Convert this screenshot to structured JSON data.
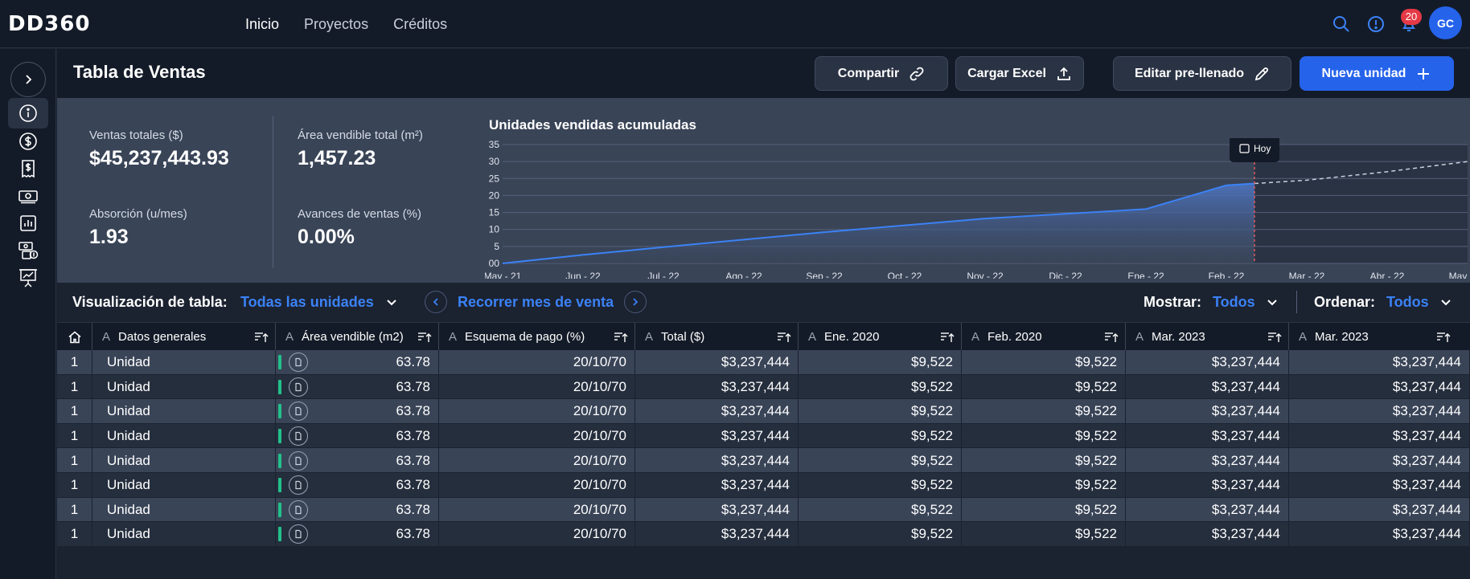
{
  "app": {
    "logo_text": "DD360"
  },
  "topnav": {
    "items": [
      "Inicio",
      "Proyectos",
      "Créditos"
    ],
    "active": "Inicio"
  },
  "notifications": {
    "count": "20"
  },
  "user": {
    "initials": "GC"
  },
  "colors": {
    "accent": "#2563eb",
    "link": "#3b82f6",
    "positive": "#22c08a",
    "badge": "#e53946",
    "today_marker": "#e05a5a"
  },
  "sidebar": {
    "icons": [
      "chevron-right-icon",
      "info-icon",
      "dollar-icon",
      "receipt-icon",
      "banknote-icon",
      "bar-chart-icon",
      "money-stack-icon",
      "presentation-chart-icon"
    ],
    "active": "info-icon"
  },
  "header": {
    "title": "Tabla de Ventas",
    "buttons": {
      "share": "Compartir",
      "upload": "Cargar Excel",
      "edit": "Editar pre-llenado",
      "new": "Nueva unidad"
    }
  },
  "kpis": {
    "total_sales_label": "Ventas totales ($)",
    "total_sales_value": "$45,237,443.93",
    "area_label": "Área vendible total (m²)",
    "area_value": "1,457.23",
    "absorption_label": "Absorción (u/mes)",
    "absorption_value": "1.93",
    "progress_label": "Avances de ventas (%)",
    "progress_value": "0.00%"
  },
  "chart_data": {
    "type": "area",
    "title": "Unidades vendidas acumuladas",
    "x": [
      "May - 21",
      "Jun - 22",
      "Jul - 22",
      "Ago - 22",
      "Sep - 22",
      "Oct - 22",
      "Nov - 22",
      "Dic - 22",
      "Ene - 22",
      "Feb - 22",
      "Mar - 22",
      "Abr - 22",
      "May - 22"
    ],
    "y_ticks": [
      "00",
      "5",
      "10",
      "15",
      "20",
      "25",
      "30",
      "35"
    ],
    "ylim": [
      0,
      35
    ],
    "series": [
      {
        "values": [
          0,
          2.5,
          4.8,
          7,
          9.2,
          11.2,
          13.2,
          14.6,
          16,
          23,
          24.5,
          27,
          30
        ]
      }
    ],
    "today_label": "Hoy",
    "today_position_x": 9.35,
    "grid": true
  },
  "table_toolbar": {
    "view_label": "Visualización de tabla:",
    "view_value": "Todas las unidades",
    "month_nav_label": "Recorrer mes de venta",
    "show_label": "Mostrar:",
    "show_value": "Todos",
    "order_label": "Ordenar:",
    "order_value": "Todos"
  },
  "table": {
    "columns": [
      "Datos generales",
      "Área vendible (m2)",
      "Esquema de pago (%)",
      "Total ($)",
      "Ene. 2020",
      "Feb. 2020",
      "Mar. 2023",
      "Mar. 2023"
    ],
    "type_marker": "A",
    "rows": [
      [
        "1",
        "Unidad",
        "63.78",
        "20/10/70",
        "$3,237,444",
        "$9,522",
        "$9,522",
        "$3,237,444",
        "$3,237,444"
      ],
      [
        "1",
        "Unidad",
        "63.78",
        "20/10/70",
        "$3,237,444",
        "$9,522",
        "$9,522",
        "$3,237,444",
        "$3,237,444"
      ],
      [
        "1",
        "Unidad",
        "63.78",
        "20/10/70",
        "$3,237,444",
        "$9,522",
        "$9,522",
        "$3,237,444",
        "$3,237,444"
      ],
      [
        "1",
        "Unidad",
        "63.78",
        "20/10/70",
        "$3,237,444",
        "$9,522",
        "$9,522",
        "$3,237,444",
        "$3,237,444"
      ],
      [
        "1",
        "Unidad",
        "63.78",
        "20/10/70",
        "$3,237,444",
        "$9,522",
        "$9,522",
        "$3,237,444",
        "$3,237,444"
      ],
      [
        "1",
        "Unidad",
        "63.78",
        "20/10/70",
        "$3,237,444",
        "$9,522",
        "$9,522",
        "$3,237,444",
        "$3,237,444"
      ],
      [
        "1",
        "Unidad",
        "63.78",
        "20/10/70",
        "$3,237,444",
        "$9,522",
        "$9,522",
        "$3,237,444",
        "$3,237,444"
      ],
      [
        "1",
        "Unidad",
        "63.78",
        "20/10/70",
        "$3,237,444",
        "$9,522",
        "$9,522",
        "$3,237,444",
        "$3,237,444"
      ]
    ]
  }
}
